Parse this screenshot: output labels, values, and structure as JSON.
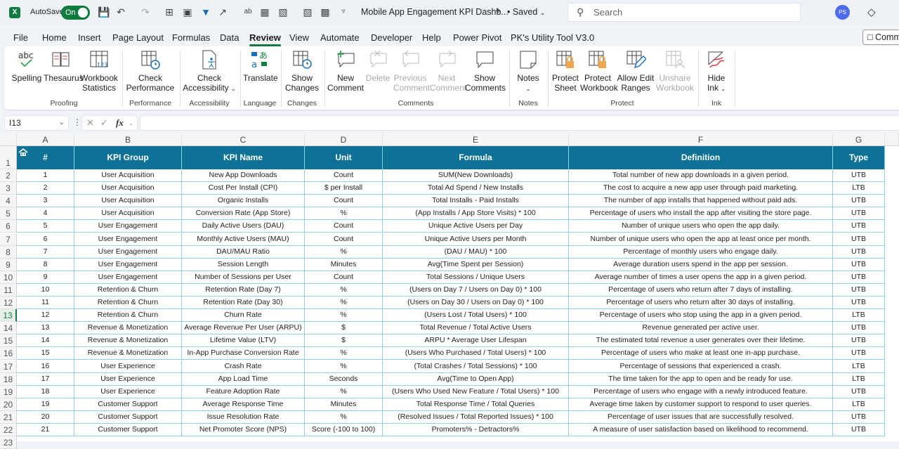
{
  "titlebar": {
    "app_icon": "excel-logo",
    "app_letter": "X",
    "autosave_label": "AutoSave",
    "autosave_state": "On",
    "document_title": "Mobile App Engagement KPI Dashb...",
    "saved_status": "• Saved",
    "search_placeholder": "Search",
    "user_initials": "PS",
    "quick_access_icons": [
      "save-sync-icon",
      "undo-icon",
      "redo-icon",
      "borders-icon",
      "picture-icon",
      "filter-icon",
      "share-icon",
      "spelling-icon",
      "form-icon",
      "calculator-icon",
      "calculator2-icon",
      "view-icon",
      "customize-qat-icon"
    ]
  },
  "menu": {
    "items": [
      "File",
      "Home",
      "Insert",
      "Page Layout",
      "Formulas",
      "Data",
      "Review",
      "View",
      "Automate",
      "Developer",
      "Help",
      "Power Pivot",
      "PK's Utility Tool V3.0"
    ],
    "active": "Review",
    "comments_button": "Comm"
  },
  "ribbon": {
    "groups": [
      {
        "label": "Proofing",
        "buttons": [
          {
            "label": "Spelling",
            "icon": "spelling-icon",
            "enabled": true
          },
          {
            "label": "Thesaurus",
            "icon": "thesaurus-icon",
            "enabled": true
          },
          {
            "label": "Workbook Statistics",
            "icon": "workbook-statistics-icon",
            "enabled": true
          }
        ]
      },
      {
        "label": "Performance",
        "buttons": [
          {
            "label": "Check Performance",
            "icon": "check-performance-icon",
            "enabled": true
          }
        ]
      },
      {
        "label": "Accessibility",
        "buttons": [
          {
            "label": "Check Accessibility",
            "icon": "accessibility-icon",
            "enabled": true
          }
        ]
      },
      {
        "label": "Language",
        "buttons": [
          {
            "label": "Translate",
            "icon": "translate-icon",
            "enabled": true
          }
        ]
      },
      {
        "label": "Changes",
        "buttons": [
          {
            "label": "Show Changes",
            "icon": "show-changes-icon",
            "enabled": true
          }
        ]
      },
      {
        "label": "Comments",
        "buttons": [
          {
            "label": "New Comment",
            "icon": "new-comment-icon",
            "enabled": true
          },
          {
            "label": "Delete",
            "icon": "delete-comment-icon",
            "enabled": false
          },
          {
            "label": "Previous Comment",
            "icon": "previous-comment-icon",
            "enabled": false
          },
          {
            "label": "Next Comment",
            "icon": "next-comment-icon",
            "enabled": false
          },
          {
            "label": "Show Comments",
            "icon": "show-comments-icon",
            "enabled": true
          }
        ]
      },
      {
        "label": "Notes",
        "buttons": [
          {
            "label": "Notes",
            "icon": "notes-icon",
            "enabled": true
          }
        ]
      },
      {
        "label": "Protect",
        "buttons": [
          {
            "label": "Protect Sheet",
            "icon": "protect-sheet-icon",
            "enabled": true
          },
          {
            "label": "Protect Workbook",
            "icon": "protect-workbook-icon",
            "enabled": true
          },
          {
            "label": "Allow Edit Ranges",
            "icon": "allow-edit-ranges-icon",
            "enabled": true
          },
          {
            "label": "Unshare Workbook",
            "icon": "unshare-workbook-icon",
            "enabled": false
          }
        ]
      },
      {
        "label": "Ink",
        "buttons": [
          {
            "label": "Hide Ink",
            "icon": "hide-ink-icon",
            "enabled": true
          }
        ]
      }
    ]
  },
  "formula_bar": {
    "name_box": "I13",
    "formula": ""
  },
  "sheet": {
    "columns": [
      "A",
      "B",
      "C",
      "D",
      "E",
      "F",
      "G"
    ],
    "selected_row": 13,
    "header_color": "#0e7196",
    "headers": [
      "#",
      "KPI Group",
      "KPI Name",
      "Unit",
      "Formula",
      "Definition",
      "Type"
    ],
    "rows": [
      [
        "1",
        "User Acquisition",
        "New App Downloads",
        "Count",
        "SUM(New Downloads)",
        "Total number of new app downloads in a given period.",
        "UTB"
      ],
      [
        "2",
        "User Acquisition",
        "Cost Per Install (CPI)",
        "$ per Install",
        "Total Ad Spend / New Installs",
        "The cost to acquire a new app user through paid marketing.",
        "LTB"
      ],
      [
        "3",
        "User Acquisition",
        "Organic Installs",
        "Count",
        "Total Installs - Paid Installs",
        "The number of app installs that happened without paid ads.",
        "UTB"
      ],
      [
        "4",
        "User Acquisition",
        "Conversion Rate (App Store)",
        "%",
        "(App Installs / App Store Visits) * 100",
        "Percentage of users who install the app after visiting the store page.",
        "UTB"
      ],
      [
        "5",
        "User Engagement",
        "Daily Active Users (DAU)",
        "Count",
        "Unique Active Users per Day",
        "Number of unique users who open the app daily.",
        "UTB"
      ],
      [
        "6",
        "User Engagement",
        "Monthly Active Users (MAU)",
        "Count",
        "Unique Active Users per Month",
        "Number of unique users who open the app at least once per month.",
        "UTB"
      ],
      [
        "7",
        "User Engagement",
        "DAU/MAU Ratio",
        "%",
        "(DAU / MAU) * 100",
        "Percentage of monthly users who engage daily.",
        "UTB"
      ],
      [
        "8",
        "User Engagement",
        "Session Length",
        "Minutes",
        "Avg(Time Spent per Session)",
        "Average duration users spend in the app per session.",
        "UTB"
      ],
      [
        "9",
        "User Engagement",
        "Number of Sessions per User",
        "Count",
        "Total Sessions / Unique Users",
        "Average number of times a user opens the app in a given period.",
        "UTB"
      ],
      [
        "10",
        "Retention & Churn",
        "Retention Rate (Day 7)",
        "%",
        "(Users on Day 7 / Users on Day 0) * 100",
        "Percentage of users who return after 7 days of installing.",
        "UTB"
      ],
      [
        "11",
        "Retention & Churn",
        "Retention Rate (Day 30)",
        "%",
        "(Users on Day 30 / Users on Day 0) * 100",
        "Percentage of users who return after 30 days of installing.",
        "UTB"
      ],
      [
        "12",
        "Retention & Churn",
        "Churn Rate",
        "%",
        "(Users Lost / Total Users) * 100",
        "Percentage of users who stop using the app in a given period.",
        "LTB"
      ],
      [
        "13",
        "Revenue & Monetization",
        "Average Revenue Per User (ARPU)",
        "$",
        "Total Revenue / Total Active Users",
        "Revenue generated per active user.",
        "UTB"
      ],
      [
        "14",
        "Revenue & Monetization",
        "Lifetime Value (LTV)",
        "$",
        "ARPU * Average User Lifespan",
        "The estimated total revenue a user generates over their lifetime.",
        "UTB"
      ],
      [
        "15",
        "Revenue & Monetization",
        "In-App Purchase Conversion Rate",
        "%",
        "(Users Who Purchased / Total Users) * 100",
        "Percentage of users who make at least one in-app purchase.",
        "UTB"
      ],
      [
        "16",
        "User Experience",
        "Crash Rate",
        "%",
        "(Total Crashes / Total Sessions) * 100",
        "Percentage of sessions that experienced a crash.",
        "LTB"
      ],
      [
        "17",
        "User Experience",
        "App Load Time",
        "Seconds",
        "Avg(Time to Open App)",
        "The time taken for the app to open and be ready for use.",
        "LTB"
      ],
      [
        "18",
        "User Experience",
        "Feature Adoption Rate",
        "%",
        "(Users Who Used New Feature / Total Users) * 100",
        "Percentage of users who engage with a newly introduced feature.",
        "UTB"
      ],
      [
        "19",
        "Customer Support",
        "Average Response Time",
        "Minutes",
        "Total Response Time / Total Queries",
        "Average time taken by customer support to respond to user queries.",
        "LTB"
      ],
      [
        "20",
        "Customer Support",
        "Issue Resolution Rate",
        "%",
        "(Resolved Issues / Total Reported Issues) * 100",
        "Percentage of user issues that are successfully resolved.",
        "UTB"
      ],
      [
        "21",
        "Customer Support",
        "Net Promoter Score (NPS)",
        "Score (-100 to 100)",
        "Promoters% - Detractors%",
        "A measure of user satisfaction based on likelihood to recommend.",
        "UTB"
      ]
    ]
  }
}
